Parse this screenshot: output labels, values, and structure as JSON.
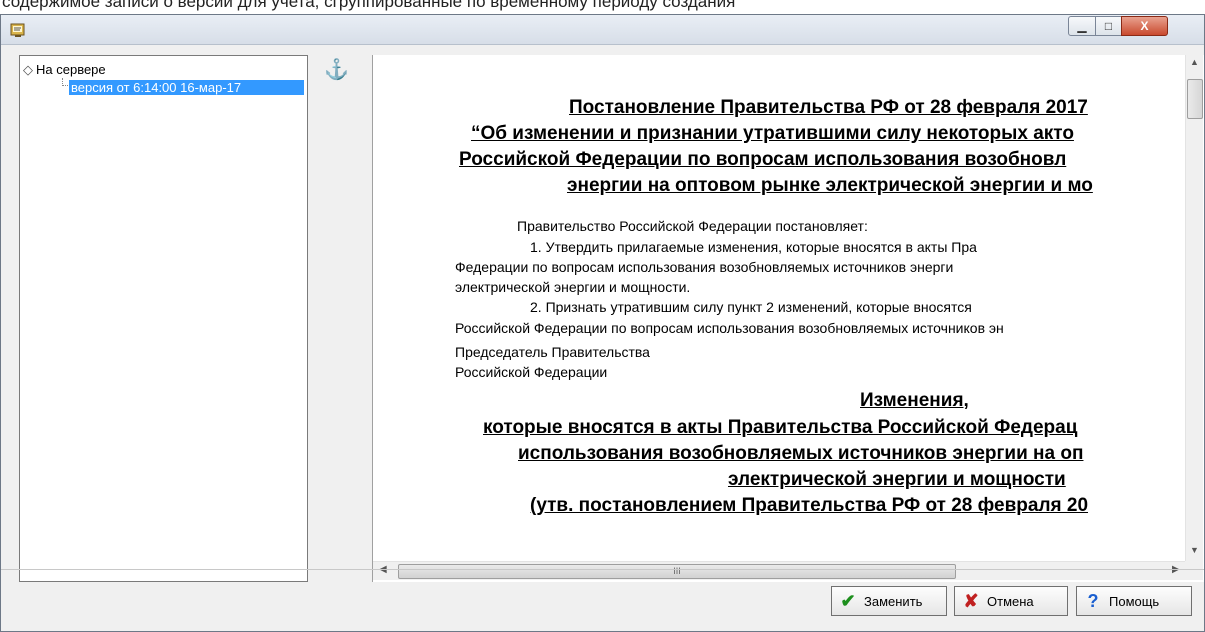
{
  "top_strip": {
    "text": "содержимое записи о версии для учета, сгруппированные по временному периоду создания"
  },
  "window": {
    "title_controls": {
      "minimize": "▁",
      "maximize": "□",
      "close": "X"
    }
  },
  "tree": {
    "root_label": "На сервере",
    "root_icon": "diamond-icon",
    "child_label": "версия от 6:14:00 16-мар-17"
  },
  "anchor_icon": "anchor-icon",
  "document": {
    "title_lines": [
      "Постановление Правительства РФ от 28 февраля 2017",
      "“Об изменении и признании утратившими силу некоторых акто",
      "Российской Федерации по вопросам использования возобновл",
      "энергии на оптовом рынке электрической энергии и мо"
    ],
    "paragraphs": [
      "Правительство Российской Федерации постановляет:",
      "1. Утвердить   прилагаемые   изменения,   которые   вносятся   в   акты   Пра",
      "Федерации   по   вопросам   использования   возобновляемых   источников   энерги",
      "электрической энергии и мощности.",
      "2. Признать   утратившим   силу   пункт 2   изменений,   которые   вносятся",
      "Российской Федерации по вопросам использования возобновляемых источников эн",
      "Председатель Правительства",
      "Российской Федерации"
    ],
    "changes_lines": [
      "Изменения,",
      "которые вносятся в акты Правительства Российской Федерац",
      "использования возобновляемых источников энергии на оп",
      "электрической энергии и мощности",
      "(утв. постановлением Правительства РФ от 28 февраля 20"
    ]
  },
  "scrollbar": {
    "h_thumb_grip": "III"
  },
  "buttons": {
    "replace": "Заменить",
    "cancel": "Отмена",
    "help": "Помощь"
  },
  "colors": {
    "selection": "#3399ff",
    "replace_icon": "#1d8f1d",
    "cancel_icon": "#c02020",
    "help_icon": "#1a5fd0"
  }
}
